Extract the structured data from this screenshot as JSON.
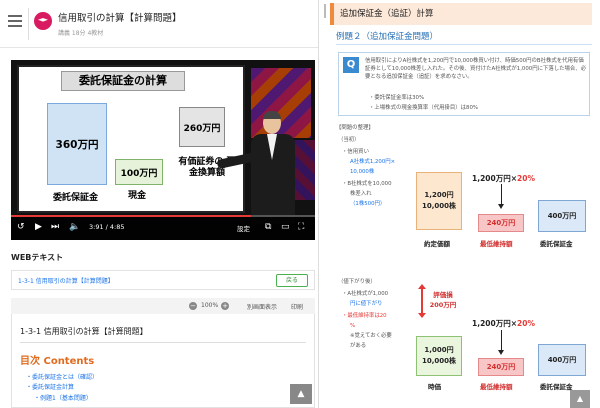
{
  "header": {
    "title": "信用取引の計算【計算問題】",
    "meta": "講義 18分 4教材"
  },
  "video": {
    "slide": {
      "title": "委託保証金の計算",
      "box_360": "360万円",
      "box_100": "100万円",
      "box_260": "260万円",
      "label_itaku": "委託保証金",
      "label_genkin": "現金",
      "label_yuka": "有価証券の 現金換算額"
    },
    "time": "3:91 / 4:85",
    "settings_label": "設定",
    "progress_fraction": 0.79,
    "controls": {
      "rewind": "↺",
      "play": "▶",
      "skip": "⏭",
      "volume": "🔈",
      "caption": "⧉",
      "screen": "▭",
      "fullscreen": "⛶"
    }
  },
  "webtext": {
    "heading": "WEBテキスト",
    "section_label": "1-3-1 信用取引の計算【計算問題】",
    "return_button": "戻る",
    "zoom": "100%",
    "zoom_minus": "−",
    "zoom_plus": "+",
    "alt_view": "別画面表示",
    "print": "印刷",
    "doc_title": "1-3-1 信用取引の計算【計算問題】",
    "toc_title": "目次 Contents",
    "toc_items": [
      "・委託保証金とは（確認）",
      "・委託保証金計算",
      "・例題1（基本問題）"
    ]
  },
  "panel": {
    "title": "追加保証金（追証）計算",
    "example_heading": "例題２（追加保証金問題）",
    "q_badge": "Q",
    "question": "信用取引によりA社株式を1,200円で10,000株買い付け、時価500円のB社株式を代用有価証券として10,000株差し入れた。その後、買付けたA社株式が1,000円に下落した場合、必要となる追加保証金（追証）を求めなさい。",
    "bullet1": "・委託保証金率は30%",
    "bullet2": "・上場株式の現金換算率（代用掛目）は80%",
    "section_label": "【問題の整理】",
    "initial_label": "（当初）",
    "initial_lines": [
      "・信用買い",
      "A社株式1,200円×",
      "10,000株",
      "・B社株式を10,000",
      "株差入れ",
      "（1株500円）"
    ],
    "drop_label": "（値下がり後）",
    "drop_lines": [
      "・A社株式が1,000",
      "円に値下がり",
      "・最低維持率は20",
      "%",
      "※覚えておく必要",
      "がある"
    ],
    "dia1": {
      "top_arrow": "1,200万円×",
      "top_pct": "20%",
      "left_box": "1,200円 10,000株",
      "pink_box": "240万円",
      "right_box": "400万円",
      "label_left": "約定価額",
      "label_pink": "最低維持額",
      "label_right": "委託保証金"
    },
    "dia2": {
      "loss_label": "評価損 200万円",
      "top_arrow": "1,200万円×",
      "top_pct": "20%",
      "left_box": "1,000円 10,000株",
      "pink_box": "240万円",
      "right_box": "400万円",
      "label_left": "時価",
      "label_pink": "最低維持額",
      "label_right": "委託保証金"
    },
    "scroll_top": "▲"
  },
  "colors": {
    "accent": "#f08a3c",
    "blue": "#3a8ad0",
    "red": "#e53935"
  }
}
